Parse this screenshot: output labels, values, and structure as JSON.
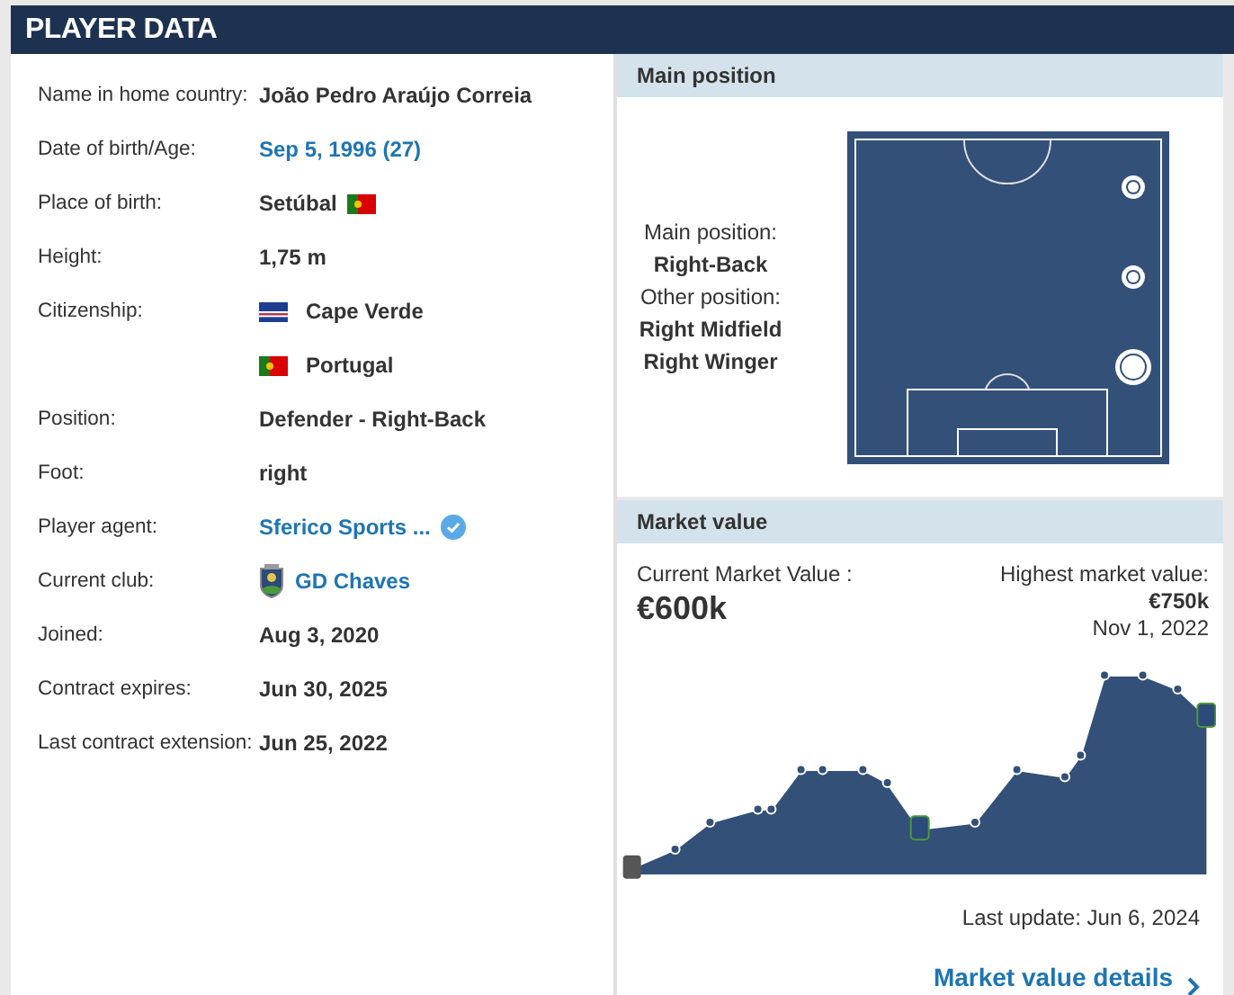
{
  "header": {
    "title": "PLAYER DATA"
  },
  "info_rows": [
    {
      "label": "Name in home country:",
      "values": [
        {
          "kind": "plain",
          "text": "João Pedro Araújo Correia"
        }
      ]
    },
    {
      "label": "Date of birth/Age:",
      "values": [
        {
          "kind": "link",
          "text": "Sep 5, 1996 (27)"
        }
      ]
    },
    {
      "label": "Place of birth:",
      "values": [
        {
          "kind": "place",
          "text": "Setúbal"
        }
      ]
    },
    {
      "label": "Height:",
      "values": [
        {
          "kind": "plain",
          "text": "1,75 m"
        }
      ]
    },
    {
      "label": "Citizenship:",
      "values": [
        {
          "kind": "country-cv",
          "text": "Cape Verde"
        },
        {
          "kind": "country-pt",
          "text": "Portugal"
        }
      ]
    },
    {
      "label": "Position:",
      "values": [
        {
          "kind": "plain",
          "text": "Defender - Right-Back"
        }
      ]
    },
    {
      "label": "Foot:",
      "values": [
        {
          "kind": "plain",
          "text": "right"
        }
      ]
    },
    {
      "label": "Player agent:",
      "values": [
        {
          "kind": "agent",
          "text": "Sferico Sports ..."
        }
      ]
    },
    {
      "label": "Current club:",
      "values": [
        {
          "kind": "club",
          "text": "GD Chaves"
        }
      ]
    },
    {
      "label": "Joined:",
      "values": [
        {
          "kind": "plain",
          "text": "Aug 3, 2020"
        }
      ]
    },
    {
      "label": "Contract expires:",
      "values": [
        {
          "kind": "plain",
          "text": "Jun 30, 2025"
        }
      ]
    },
    {
      "label": "Last contract extension:",
      "values": [
        {
          "kind": "plain",
          "text": "Jun 25, 2022"
        }
      ]
    }
  ],
  "main_position": {
    "title": "Main position",
    "main_label": "Main position:",
    "main": "Right-Back",
    "other_label": "Other position:",
    "others": [
      "Right Midfield",
      "Right Winger"
    ]
  },
  "market_value": {
    "title": "Market value",
    "current_label": "Current Market Value :",
    "current_value": "€600k",
    "highest_label": "Highest market value:",
    "highest_value": "€750k",
    "highest_date": "Nov 1, 2022",
    "last_update": "Last update: Jun 6, 2024",
    "details_link": "Market value details"
  }
}
